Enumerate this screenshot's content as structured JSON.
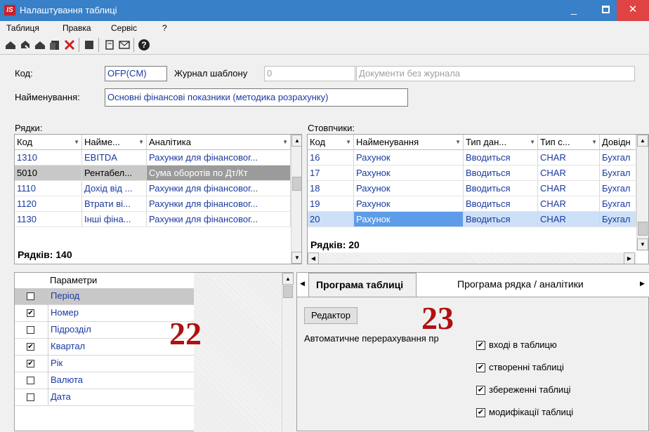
{
  "window": {
    "title": "Налаштування таблиці",
    "logo": "IS"
  },
  "menu": [
    "Таблиця",
    "Правка",
    "Сервіс",
    "?"
  ],
  "toolbar": {
    "icons": [
      "add-icon",
      "edit-icon",
      "copy-icon",
      "paste-icon",
      "delete-icon",
      "save-icon",
      "page-icon",
      "mail-icon",
      "help-icon"
    ]
  },
  "form": {
    "code_label": "Код:",
    "code_value": "OFP(CM)",
    "journal_label": "Журнал шаблону",
    "journal_value": "0",
    "journal_name": "Документи без журнала",
    "name_label": "Найменування:",
    "name_value": "Основні фінансові показники (методика розрахунку)"
  },
  "rows_panel": {
    "label": "Рядки:",
    "headers": [
      "Код",
      "Найме...",
      "Аналітика"
    ],
    "rows": [
      {
        "code": "1310",
        "name": "EBITDA",
        "analytics": "Рахунки для фінансовог..."
      },
      {
        "code": "5010",
        "name": "Рентабел...",
        "analytics": "Сума оборотів по Дт/Кт"
      },
      {
        "code": "1110",
        "name": "Дохід від ...",
        "analytics": "Рахунки для фінансовог..."
      },
      {
        "code": "1120",
        "name": "Втрати ві...",
        "analytics": "Рахунки для фінансовог..."
      },
      {
        "code": "1130",
        "name": "Інші фіна...",
        "analytics": "Рахунки для фінансовог..."
      }
    ],
    "count_text": "Рядків: 140"
  },
  "cols_panel": {
    "label": "Стовпчики:",
    "headers": [
      "Код",
      "Найменування",
      "Тип дан...",
      "Тип с...",
      "Довідн"
    ],
    "rows": [
      {
        "code": "16",
        "name": "Рахунок",
        "type": "Вводиться",
        "stype": "CHAR",
        "ref": "Бухгал"
      },
      {
        "code": "17",
        "name": "Рахунок",
        "type": "Вводиться",
        "stype": "CHAR",
        "ref": "Бухгал"
      },
      {
        "code": "18",
        "name": "Рахунок",
        "type": "Вводиться",
        "stype": "CHAR",
        "ref": "Бухгал"
      },
      {
        "code": "19",
        "name": "Рахунок",
        "type": "Вводиться",
        "stype": "CHAR",
        "ref": "Бухгал"
      },
      {
        "code": "20",
        "name": "Рахунок",
        "type": "Вводиться",
        "stype": "CHAR",
        "ref": "Бухгал"
      }
    ],
    "count_text": "Рядків: 20"
  },
  "params_panel": {
    "header": "Параметри",
    "items": [
      {
        "label": "Період",
        "checked": false
      },
      {
        "label": "Номер",
        "checked": true
      },
      {
        "label": "Підрозділ",
        "checked": false
      },
      {
        "label": "Квартал",
        "checked": true
      },
      {
        "label": "Рік",
        "checked": true
      },
      {
        "label": "Валюта",
        "checked": false
      },
      {
        "label": "Дата",
        "checked": false
      }
    ],
    "big_number": "22"
  },
  "program_panel": {
    "tabs": [
      "Програма таблиці",
      "Програма рядка / аналітики"
    ],
    "editor_button": "Редактор",
    "auto_label": "Автоматичне перерахування пр",
    "checks": [
      {
        "label": "вході в таблицю",
        "checked": true
      },
      {
        "label": "створенні таблиці",
        "checked": true
      },
      {
        "label": "збереженні таблиці",
        "checked": true
      },
      {
        "label": "модифікації таблиці",
        "checked": true
      }
    ],
    "big_number": "23"
  }
}
